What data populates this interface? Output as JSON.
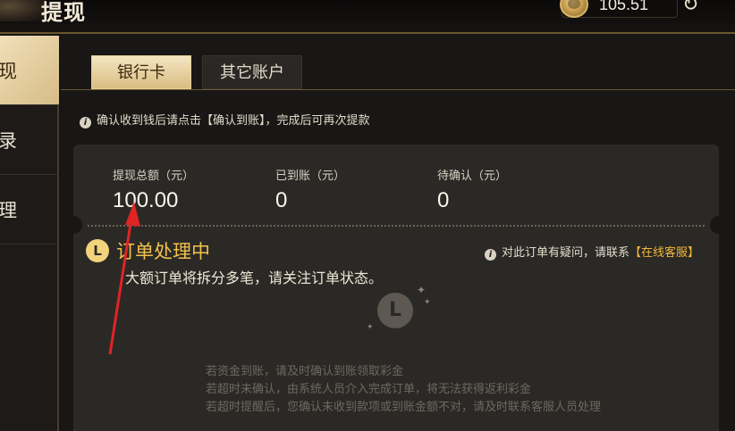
{
  "header": {
    "title": "提现",
    "balance": "105.51"
  },
  "sidebar": {
    "items": [
      {
        "label": "现",
        "active": true
      },
      {
        "label": "录",
        "active": false
      },
      {
        "label": "理",
        "active": false
      }
    ]
  },
  "tabs": [
    {
      "label": "银行卡",
      "active": true
    },
    {
      "label": "其它账户",
      "active": false
    }
  ],
  "notice": "确认收到钱后请点击【确认到账】，完成后可再次提款",
  "stats": [
    {
      "label": "提现总额（元）",
      "value": "100.00"
    },
    {
      "label": "已到账（元）",
      "value": "0"
    },
    {
      "label": "待确认（元）",
      "value": "0"
    }
  ],
  "order": {
    "status_title": "订单处理中",
    "status_desc": "大额订单将拆分多笔，请关注订单状态。",
    "help_text": "对此订单有疑问，请联系",
    "help_link": "【在线客服】"
  },
  "tips": [
    "若资金到账，请及时确认到账领取彩金",
    "若超时未确认，由系统人员介入完成订单，将无法获得返利彩金",
    "若超时提醒后，您确认未收到款项或到账金额不对，请及时联系客服人员处理"
  ],
  "colors": {
    "accent_gold": "#f1c14b",
    "link_orange": "#f1b83c",
    "arrow_red": "#e02424"
  }
}
